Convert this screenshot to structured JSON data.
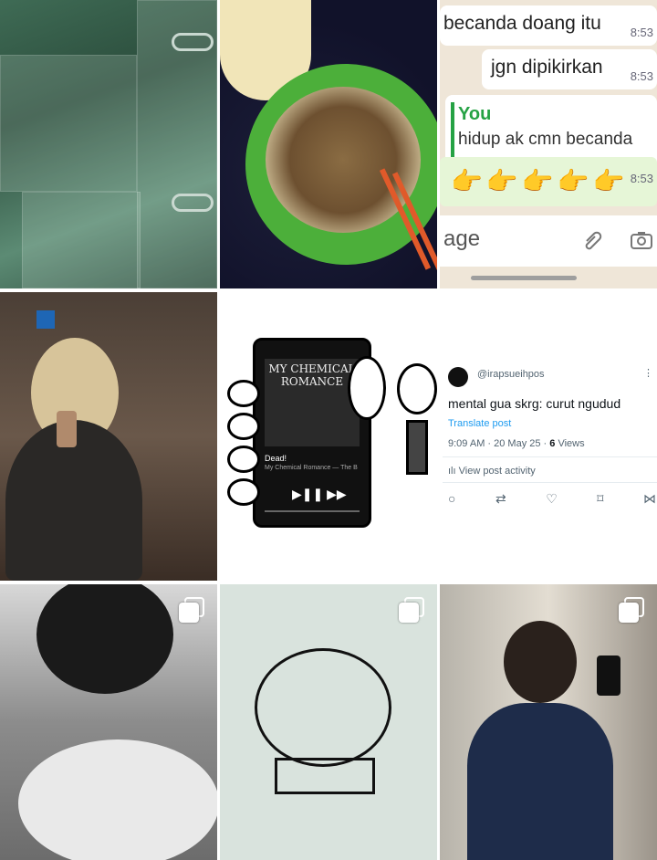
{
  "grid": {
    "chat": {
      "msg1": "becanda doang itu",
      "msg1_time": "8:53",
      "msg2": "jgn dipikirkan",
      "msg2_time": "8:53",
      "reply_name": "You",
      "reply_text": "hidup ak cmn becanda",
      "emoji_row": "👉👉👉👉👉👉",
      "emoji_time": "8:53",
      "input_placeholder": "age"
    },
    "album": {
      "band": "MY CHEMICAL ROMANCE",
      "track": "Dead!",
      "artist": "My Chemical Romance — The B"
    },
    "tweet": {
      "handle": "@irapsueihpos",
      "text": "mental gua skrg: curut ngudud",
      "translate": "Translate post",
      "meta_prefix": "9:09 AM · 20 May 25 · ",
      "views_count": "6",
      "views_label": " Views",
      "activity": "View post activity",
      "more": "⋮"
    }
  },
  "icons": {
    "comment": "○",
    "retweet": "⇄",
    "like": "♡",
    "bookmark": "⌑",
    "share": "⋈",
    "play_controls": "▶❚❚ ▶▶",
    "multi": "multiple-images-icon"
  }
}
